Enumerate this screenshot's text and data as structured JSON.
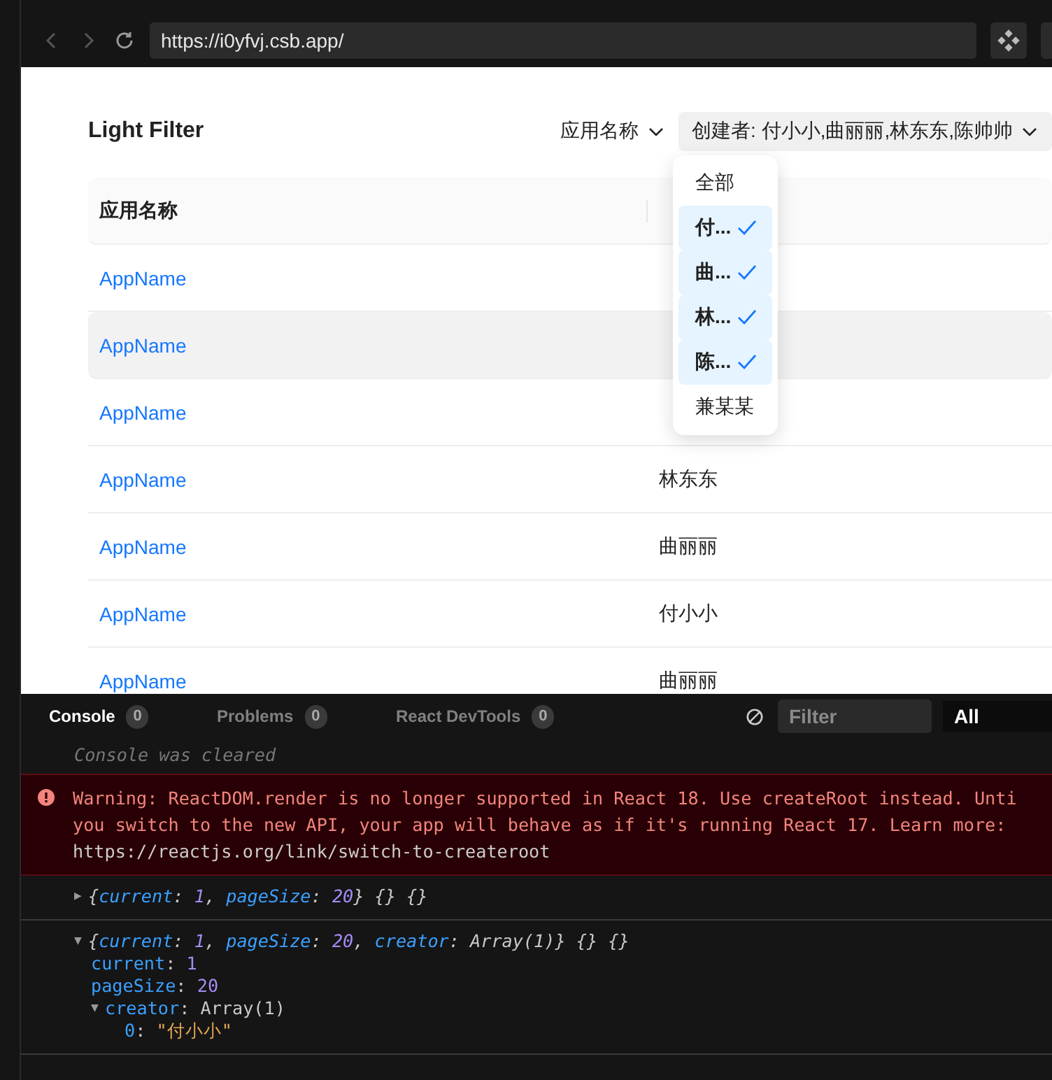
{
  "browser": {
    "url": "https://i0yfvj.csb.app/"
  },
  "page": {
    "title": "Light Filter",
    "filters": [
      {
        "label": "应用名称",
        "active": false
      },
      {
        "label": "创建者: 付小小,曲丽丽,林东东,陈帅帅",
        "active": true
      }
    ],
    "dropdown": [
      {
        "label": "全部",
        "checked": false
      },
      {
        "label": "付...",
        "checked": true
      },
      {
        "label": "曲...",
        "checked": true
      },
      {
        "label": "林...",
        "checked": true
      },
      {
        "label": "陈...",
        "checked": true
      },
      {
        "label": "兼某某",
        "checked": false
      }
    ],
    "table": {
      "columns": [
        "应用名称"
      ],
      "rows": [
        {
          "name": "AppName",
          "hovered": false
        },
        {
          "name": "AppName",
          "hovered": true
        },
        {
          "name": "AppName",
          "hovered": false
        },
        {
          "name": "AppName",
          "creator": "林东东",
          "hovered": false
        },
        {
          "name": "AppName",
          "creator": "曲丽丽",
          "hovered": false
        },
        {
          "name": "AppName",
          "creator": "付小小",
          "hovered": false
        },
        {
          "name": "AppName",
          "creator": "曲丽丽",
          "hovered": false
        }
      ]
    }
  },
  "devtools": {
    "tabs": [
      {
        "label": "Console",
        "count": "0",
        "selected": true
      },
      {
        "label": "Problems",
        "count": "0",
        "selected": false
      },
      {
        "label": "React DevTools",
        "count": "0",
        "selected": false
      }
    ],
    "filter": {
      "placeholder": "Filter"
    },
    "level": "All",
    "cleared": "Console was cleared",
    "error": [
      "Warning: ReactDOM.render is no longer supported in React 18. Use createRoot instead. Unti",
      "you switch to the new API, your app will behave as if it's running React 17. Learn more:",
      "https://reactjs.org/link/switch-to-createroot"
    ],
    "logs": [
      {
        "toggle": "▶",
        "summary": [
          {
            "text": "{",
            "kind": "punct"
          },
          {
            "text": "current",
            "kind": "key"
          },
          {
            "text": ": ",
            "kind": "punct"
          },
          {
            "text": "1",
            "kind": "num"
          },
          {
            "text": ", ",
            "kind": "punct"
          },
          {
            "text": "pageSize",
            "kind": "key"
          },
          {
            "text": ": ",
            "kind": "punct"
          },
          {
            "text": "20",
            "kind": "num"
          },
          {
            "text": "} {} {}",
            "kind": "punct"
          }
        ]
      },
      {
        "toggle": "▼",
        "summary": [
          {
            "text": "{",
            "kind": "punct"
          },
          {
            "text": "current",
            "kind": "key"
          },
          {
            "text": ": ",
            "kind": "punct"
          },
          {
            "text": "1",
            "kind": "num"
          },
          {
            "text": ", ",
            "kind": "punct"
          },
          {
            "text": "pageSize",
            "kind": "key"
          },
          {
            "text": ": ",
            "kind": "punct"
          },
          {
            "text": "20",
            "kind": "num"
          },
          {
            "text": ", ",
            "kind": "punct"
          },
          {
            "text": "creator",
            "kind": "key"
          },
          {
            "text": ": Array(1)} {} {}",
            "kind": "punct"
          }
        ],
        "children": [
          {
            "key": "current",
            "sep": ":",
            "value": "1",
            "kind": "num"
          },
          {
            "key": "pageSize",
            "sep": ":",
            "value": "20",
            "kind": "num"
          },
          {
            "key": "creator",
            "sep": ":",
            "value": "Array(1)",
            "kind": "plain",
            "toggle": "▼",
            "children": [
              {
                "key": "0",
                "sep": ":",
                "value": "\"付小小\"",
                "kind": "str"
              }
            ]
          }
        ]
      }
    ]
  }
}
